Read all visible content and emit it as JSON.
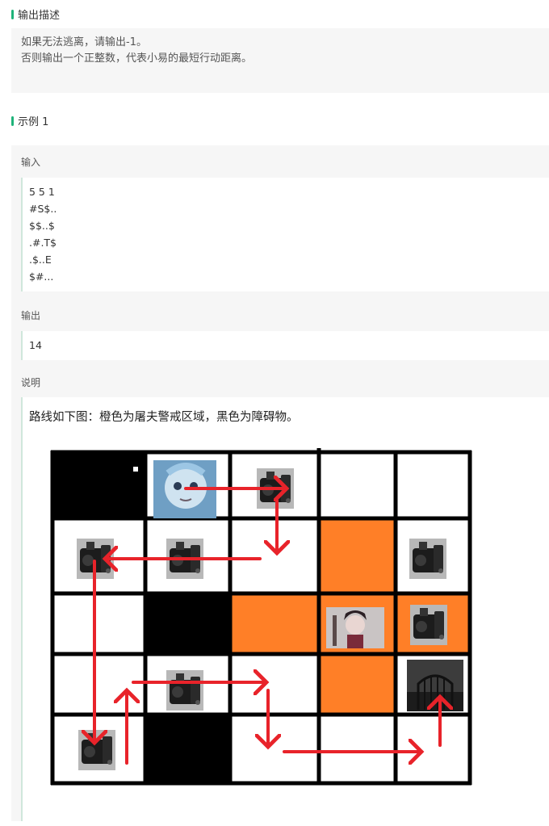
{
  "output_desc": {
    "title": "输出描述",
    "line1": "如果无法逃离，请输出-1。",
    "line2": "否则输出一个正整数，代表小易的最短行动距离。"
  },
  "example": {
    "title": "示例 1",
    "input_label": "输入",
    "input_lines": [
      "5 5 1",
      "#S$..",
      "$$..$",
      ".#.T$",
      ".$..E",
      "$#..."
    ],
    "output_label": "输出",
    "output_value": "14",
    "explain_label": "说明",
    "explain_text": "路线如下图：橙色为屠夫警戒区域，黑色为障碍物。"
  },
  "grid": {
    "rows": [
      [
        "black",
        "player",
        "motor",
        "white",
        "white"
      ],
      [
        "motor",
        "motor",
        "white",
        "orange",
        "motor"
      ],
      [
        "white",
        "black",
        "orange",
        "butcher",
        "motor-orange"
      ],
      [
        "white",
        "motor",
        "white",
        "orange",
        "gate"
      ],
      [
        "motor",
        "black",
        "white",
        "white",
        "white"
      ]
    ],
    "colors": {
      "orange": "#ff7f27",
      "black": "#000000",
      "white": "#ffffff",
      "arrow": "#e8232a",
      "accent": "#1fb37a"
    }
  }
}
